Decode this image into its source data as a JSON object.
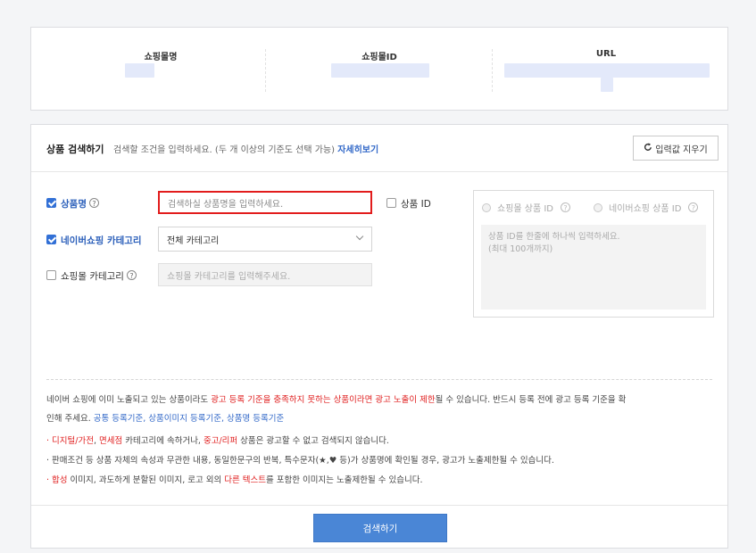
{
  "info": {
    "col1_label": "쇼핑몰명",
    "col2_label": "쇼핑몰ID",
    "col3_label": "URL"
  },
  "search": {
    "title": "상품 검색하기",
    "desc": "검색할 조건을 입력하세요. (두 개 이상의 기준도 선택 가능)",
    "more_link": "자세히보기",
    "reset_label": "입력값 지우기",
    "product_name_label": "상품명",
    "product_name_placeholder": "검색하실 상품명을 입력하세요.",
    "product_id_label": "상품 ID",
    "naver_category_label": "네이버쇼핑 카테고리",
    "naver_category_value": "전체 카테고리",
    "mall_category_label": "쇼핑몰 카테고리",
    "mall_category_placeholder": "쇼핑몰 카테고리를 입력해주세요.",
    "radio_mall_id": "쇼핑몰 상품 ID",
    "radio_naver_id": "네이버쇼핑 상품 ID",
    "id_text_line1": "상품 ID를 한줄에 하나씩 입력하세요.",
    "id_text_line2": "(최대 100개까지)",
    "search_button": "검색하기"
  },
  "notice": {
    "l1_a": "네이버 쇼핑에 이미 노출되고 있는 상품이라도 ",
    "l1_b": "광고 등록 기준을 충족하지 못하는 상품이라면 광고 노출이 제한",
    "l1_c": "될 수 있습니다. 반드시 등록 전에 광고 등록 기준을 확",
    "l2_a": "인해 주세요. ",
    "l2_links": "공통 등록기준, 상품이미지 등록기준, 상품명 등록기준",
    "b1_a": "디지털/가전",
    "b1_b": ", ",
    "b1_c": "면세점",
    "b1_d": " 카테고리에 속하거나, ",
    "b1_e": "중고/리퍼",
    "b1_f": " 상품은 광고할 수 없고 검색되지 않습니다.",
    "b2": "판매조건 등 상품 자체의 속성과 무관한 내용, 동일한문구의 반복, 특수문자(★,♥ 등)가 상품명에 확인될 경우, 광고가 노출제한될 수 있습니다.",
    "b3_a": "합성",
    "b3_b": " 이미지, 과도하게 분할된 이미지, 로고 외의 ",
    "b3_c": "다른 텍스트",
    "b3_d": "를 포함한 이미지는 노출제한될 수 있습니다."
  }
}
